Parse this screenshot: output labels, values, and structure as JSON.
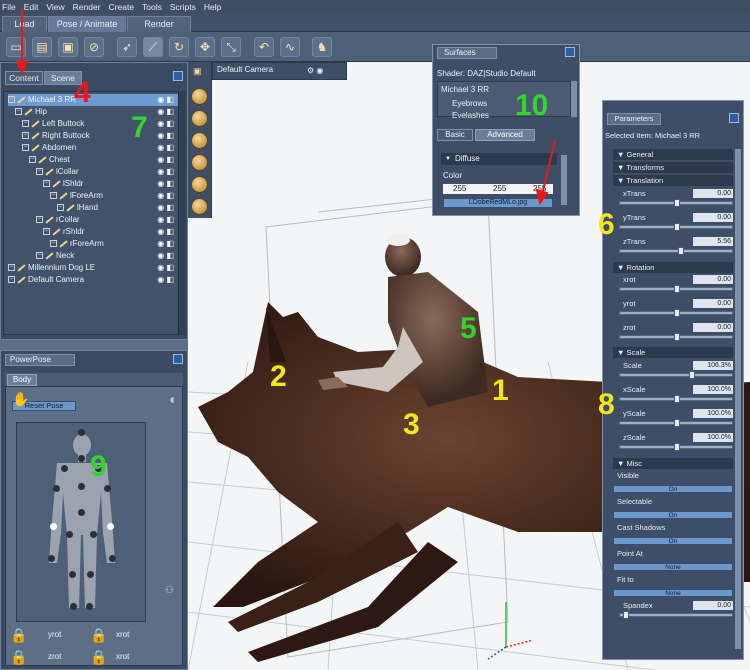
{
  "menu": [
    "File",
    "Edit",
    "View",
    "Render",
    "Create",
    "Tools",
    "Scripts",
    "Help"
  ],
  "top_tabs": [
    "Load",
    "Pose / Animate",
    "Render"
  ],
  "left_tabs": [
    "Content",
    "Scene"
  ],
  "scene_tree": [
    {
      "label": "Michael 3 RR",
      "indent": 0
    },
    {
      "label": "Hip",
      "indent": 1
    },
    {
      "label": "Left Buttock",
      "indent": 2
    },
    {
      "label": "Right Buttock",
      "indent": 2
    },
    {
      "label": "Abdomen",
      "indent": 2
    },
    {
      "label": "Chest",
      "indent": 3
    },
    {
      "label": "lCollar",
      "indent": 4
    },
    {
      "label": "lShldr",
      "indent": 5
    },
    {
      "label": "lForeArm",
      "indent": 6
    },
    {
      "label": "lHand",
      "indent": 7
    },
    {
      "label": "rCollar",
      "indent": 4
    },
    {
      "label": "rShldr",
      "indent": 5
    },
    {
      "label": "rForeArm",
      "indent": 6
    },
    {
      "label": "Neck",
      "indent": 4
    },
    {
      "label": "Millennium Dog LE",
      "indent": 0
    },
    {
      "label": "Default Camera",
      "indent": 0
    }
  ],
  "powerpose": {
    "title": "PowerPose",
    "tab": "Body",
    "reset": "Reset Pose",
    "labels": [
      "yrot",
      "xrot",
      "zrot",
      "xrot"
    ]
  },
  "camera": "Default Camera",
  "surfaces": {
    "title": "Surfaces",
    "shader": "Shader: DAZ|Studio Default",
    "items": [
      "Michael 3 RR",
      "Eyebrows",
      "Eyelashes"
    ],
    "tabs": [
      "Basic",
      "Advanced"
    ],
    "section": "Diffuse",
    "color_label": "Color",
    "rgb": [
      "255",
      "255",
      "255"
    ],
    "texture": "LDobeRedMLo.jpg"
  },
  "params": {
    "title": "Parameters",
    "selected": "Selected Item: Michael 3 RR",
    "sections": {
      "general": "General",
      "transforms": "Transforms",
      "translation": "Translation",
      "rotation": "Rotation",
      "scale": "Scale",
      "misc": "Misc"
    },
    "rows": [
      {
        "label": "xTrans",
        "value": "0.00"
      },
      {
        "label": "yTrans",
        "value": "0.00"
      },
      {
        "label": "zTrans",
        "value": "5.56"
      },
      {
        "label": "xrot",
        "value": "0.00"
      },
      {
        "label": "yrot",
        "value": "0.00"
      },
      {
        "label": "zrot",
        "value": "0.00"
      },
      {
        "label": "Scale",
        "value": "106.3%"
      },
      {
        "label": "xScale",
        "value": "100.0%"
      },
      {
        "label": "yScale",
        "value": "100.0%"
      },
      {
        "label": "zScale",
        "value": "100.0%"
      }
    ],
    "misc": [
      {
        "label": "Visible",
        "btn": "On"
      },
      {
        "label": "Selectable",
        "btn": "On"
      },
      {
        "label": "Cast Shadows",
        "btn": "On"
      },
      {
        "label": "Point At",
        "btn": "None"
      },
      {
        "label": "Fit to",
        "btn": "None"
      }
    ],
    "spandex": {
      "label": "Spandex",
      "value": "0.00"
    }
  },
  "annotations": [
    "1",
    "2",
    "3",
    "4",
    "5",
    "6",
    "7",
    "8",
    "9",
    "10"
  ],
  "colors": {
    "annotation_yellow": "#f5e61a",
    "annotation_green": "#35d42d",
    "annotation_red": "#e81919",
    "panel": "#3e4e66"
  }
}
